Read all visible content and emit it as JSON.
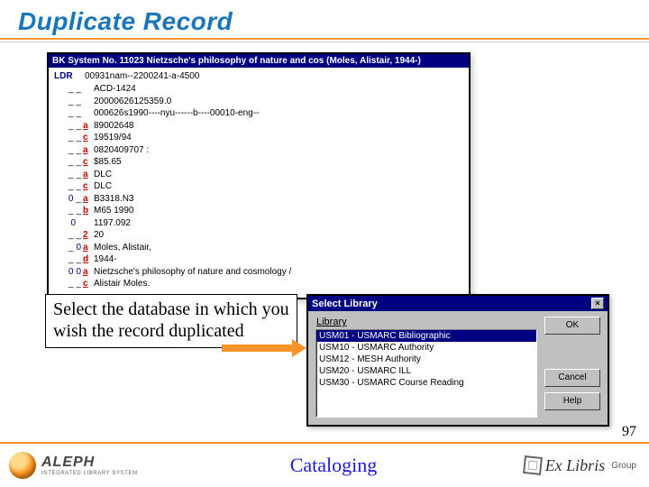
{
  "slide": {
    "title": "Duplicate Record",
    "page_number": "97",
    "footer_center": "Cataloging",
    "aleph_name": "ALEPH",
    "aleph_sub": "INTEGRATED LIBRARY SYSTEM",
    "exlibris_name": "Ex Libris",
    "exlibris_group": "Group"
  },
  "callout": {
    "text": "Select the database in which you wish the record duplicated"
  },
  "record_window": {
    "title": "BK System No. 11023 Nietzsche's philosophy of nature and cos (Moles, Alistair, 1944-)",
    "ldr_label": "LDR",
    "ldr_value": "00931nam--2200241-a-4500",
    "fields": [
      {
        "ind": [
          "_",
          "_"
        ],
        "sub": "",
        "val": "ACD-1424"
      },
      {
        "ind": [
          "_",
          "_"
        ],
        "sub": "",
        "val": "20000626125359.0"
      },
      {
        "ind": [
          "_",
          "_"
        ],
        "sub": "",
        "val": "000626s1990----nyu------b----00010-eng--"
      },
      {
        "ind": [
          "_",
          "_"
        ],
        "sub": "a",
        "val": "89002648"
      },
      {
        "ind": [
          "_",
          "_"
        ],
        "sub": "c",
        "val": "19519/94"
      },
      {
        "ind": [
          "_",
          "_"
        ],
        "sub": "a",
        "val": "0820409707 :"
      },
      {
        "ind": [
          "_",
          "_"
        ],
        "sub": "c",
        "val": "$85.65"
      },
      {
        "ind": [
          "_",
          "_"
        ],
        "sub": "a",
        "val": "DLC"
      },
      {
        "ind": [
          "_",
          "_"
        ],
        "sub": "c",
        "val": "DLC"
      },
      {
        "ind": [
          "0",
          "_"
        ],
        "sub": "a",
        "val": "B3318.N3"
      },
      {
        "ind": [
          "_",
          "_"
        ],
        "sub": "b",
        "val": "M65 1990"
      },
      {
        "ind": [
          "0",
          "",
          ""
        ],
        "sub": "",
        "val": "1197.092"
      },
      {
        "ind": [
          "_",
          "_"
        ],
        "sub": "2",
        "val": "20"
      },
      {
        "ind": [
          "_",
          "0"
        ],
        "sub": "a",
        "val": "Moles, Alistair,"
      },
      {
        "ind": [
          "_",
          "_"
        ],
        "sub": "d",
        "val": "1944-"
      },
      {
        "ind": [
          "0",
          "0"
        ],
        "sub": "a",
        "val": "Nietzsche's philosophy of nature and cosmology /"
      },
      {
        "ind": [
          "_",
          "_"
        ],
        "sub": "c",
        "val": "Alistair Moles."
      }
    ]
  },
  "dialog": {
    "title": "Select Library",
    "close": "×",
    "list_label": "Library",
    "options": [
      {
        "label": "USM01 - USMARC Bibliographic",
        "selected": true
      },
      {
        "label": "USM10 - USMARC Authority",
        "selected": false
      },
      {
        "label": "USM12 - MESH Authority",
        "selected": false
      },
      {
        "label": "USM20 - USMARC ILL",
        "selected": false
      },
      {
        "label": "USM30 - USMARC Course Reading",
        "selected": false
      }
    ],
    "buttons": {
      "ok": "OK",
      "cancel": "Cancel",
      "help": "Help"
    }
  }
}
